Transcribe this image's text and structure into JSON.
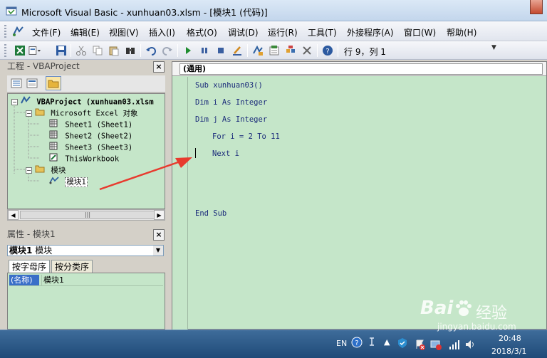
{
  "window": {
    "title": "Microsoft Visual Basic - xunhuan03.xlsm - [模块1 (代码)]"
  },
  "menu": [
    "文件(F)",
    "编辑(E)",
    "视图(V)",
    "插入(I)",
    "格式(O)",
    "调试(D)",
    "运行(R)",
    "工具(T)",
    "外接程序(A)",
    "窗口(W)",
    "帮助(H)"
  ],
  "toolbar": {
    "icons": [
      "excel-icon",
      "insert-dropdown-icon",
      "save-icon",
      "cut-icon",
      "copy-icon",
      "paste-icon",
      "find-icon",
      "undo-icon",
      "redo-icon",
      "run-icon",
      "break-icon",
      "reset-icon",
      "design-mode-icon",
      "project-explorer-icon",
      "properties-icon",
      "object-browser-icon",
      "toolbox-icon",
      "help-icon"
    ],
    "cursor_position": "行 9，列 1"
  },
  "project_pane": {
    "title": "工程 - VBAProject",
    "close": "×",
    "tree": [
      {
        "label": "VBAProject (xunhuan03.xlsm",
        "level": 0,
        "expander": "−",
        "icon": "vba-project-icon",
        "bold": true
      },
      {
        "label": "Microsoft Excel 对象",
        "level": 1,
        "expander": "−",
        "icon": "folder-open-icon"
      },
      {
        "label": "Sheet1 (Sheet1)",
        "level": 2,
        "icon": "sheet-icon"
      },
      {
        "label": "Sheet2 (Sheet2)",
        "level": 2,
        "icon": "sheet-icon"
      },
      {
        "label": "Sheet3 (Sheet3)",
        "level": 2,
        "icon": "sheet-icon"
      },
      {
        "label": "ThisWorkbook",
        "level": 2,
        "icon": "workbook-icon"
      },
      {
        "label": "模块",
        "level": 1,
        "expander": "−",
        "icon": "folder-open-icon"
      },
      {
        "label": "模块1",
        "level": 2,
        "icon": "module-icon",
        "selected": true
      }
    ],
    "scroll_thumb": "|||"
  },
  "properties_pane": {
    "title": "属性 - 模块1",
    "close": "×",
    "object_select": {
      "name": "模块1",
      "type": "模块"
    },
    "tabs": [
      "按字母序",
      "按分类序"
    ],
    "rows": [
      {
        "name": "(名称)",
        "value": "模块1"
      }
    ]
  },
  "code_window": {
    "object_combo": "(通用)",
    "lines": [
      {
        "text": "Sub xunhuan03()",
        "indent": 0,
        "row": 0
      },
      {
        "text": "Dim i As Integer",
        "indent": 0,
        "row": 2
      },
      {
        "text": "Dim j As Integer",
        "indent": 0,
        "row": 4
      },
      {
        "text": "For i = 2 To 11",
        "indent": 1,
        "row": 6
      },
      {
        "text": "Next i",
        "indent": 1,
        "row": 8
      },
      {
        "text": "End Sub",
        "indent": 0,
        "row": 15
      }
    ]
  },
  "taskbar": {
    "lang": "EN",
    "time": "20:48",
    "date": "2018/3/1"
  },
  "watermark": {
    "brand_a": "Bai",
    "brand_b": "经验",
    "url": "jingyan.baidu.com"
  },
  "colors": {
    "code_background": "#c5e6c9",
    "code_text": "#1a2a7a",
    "annotation_arrow": "#e83a2e"
  }
}
